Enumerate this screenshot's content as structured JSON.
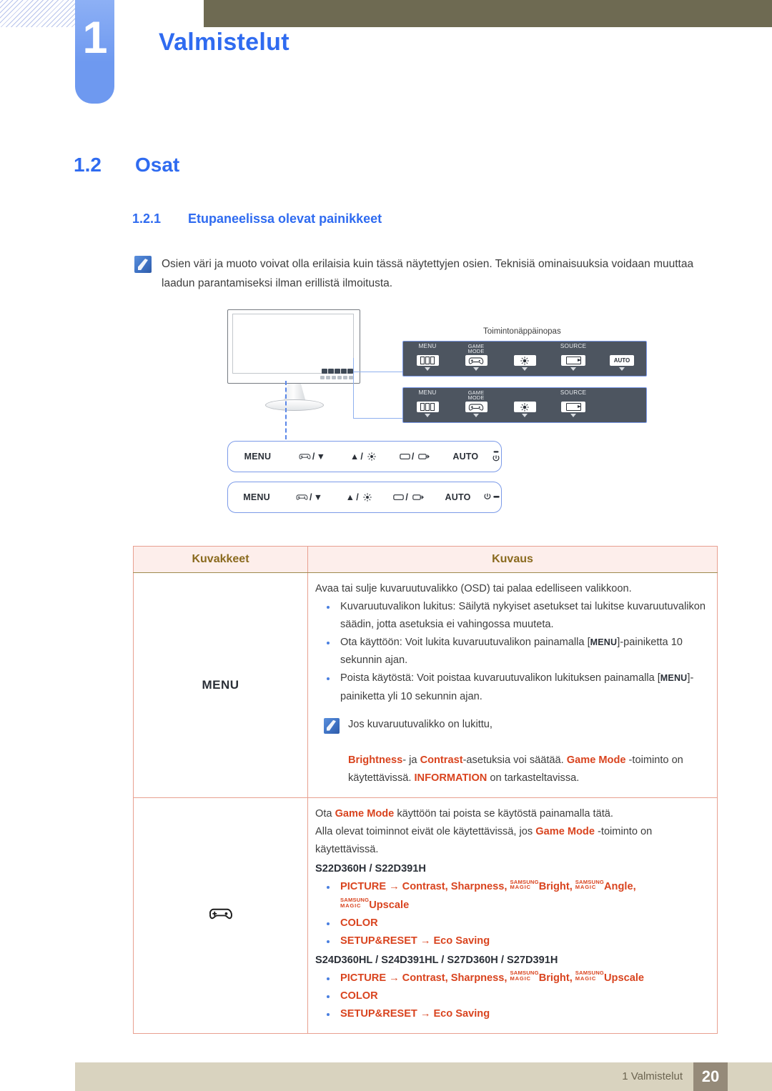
{
  "header": {
    "chapter_number": "1",
    "chapter_title": "Valmistelut"
  },
  "section": {
    "h2_number": "1.2",
    "h2_title": "Osat",
    "h3_number": "1.2.1",
    "h3_title": "Etupaneelissa olevat painikkeet"
  },
  "note": {
    "icon": "note-icon",
    "text": "Osien väri ja muoto voivat olla erilaisia kuin tässä näytettyjen osien. Teknisiä ominaisuuksia voidaan muuttaa laadun parantamiseksi ilman erillistä ilmoitusta."
  },
  "figure": {
    "guide_label": "Toimintonäppäinopas",
    "osd_panel_top": [
      {
        "caption": "MENU",
        "key": "menu-glyph",
        "arrow": true
      },
      {
        "caption": "GAME\nMODE",
        "key": "gamepad-glyph",
        "arrow": true
      },
      {
        "caption": "",
        "key": "brightness-glyph",
        "arrow": true
      },
      {
        "caption": "SOURCE",
        "key": "source-glyph",
        "arrow": true
      },
      {
        "caption": "",
        "key": "AUTO",
        "arrow": true
      }
    ],
    "osd_panel_bottom": [
      {
        "caption": "MENU",
        "key": "menu-glyph",
        "arrow": true
      },
      {
        "caption": "GAME\nMODE",
        "key": "gamepad-glyph",
        "arrow": true
      },
      {
        "caption": "",
        "key": "brightness-glyph",
        "arrow": true
      },
      {
        "caption": "SOURCE",
        "key": "source-glyph",
        "arrow": true
      }
    ],
    "button_bar_top": [
      "MENU",
      "gamepad/▼",
      "▲/brightness",
      "source/input",
      "AUTO",
      "power-led"
    ],
    "button_bar_bottom": [
      "MENU",
      "gamepad/▼",
      "▲/brightness",
      "source/input",
      "AUTO",
      "power-led"
    ],
    "bar_labels": {
      "menu": "MENU",
      "auto": "AUTO"
    }
  },
  "table": {
    "headers": {
      "icons": "Kuvakkeet",
      "description": "Kuvaus"
    },
    "rows": [
      {
        "icon_label": "MENU",
        "intro": "Avaa tai sulje kuvaruutuvalikko (OSD) tai palaa edelliseen valikkoon.",
        "bullets": [
          {
            "pre": "Kuvaruutuvalikon lukitus: Säilytä nykyiset asetukset tai lukitse kuvaruutuvalikon säädin, jotta asetuksia ei vahingossa muuteta."
          },
          {
            "pre": "Ota käyttöön: Voit lukita kuvaruutuvalikon painamalla [",
            "kbd": "MENU",
            "post": "]-painiketta 10 sekunnin ajan."
          },
          {
            "pre": "Poista käytöstä: Voit poistaa kuvaruutuvalikon lukituksen painamalla [",
            "kbd": "MENU",
            "post": "]-painiketta yli 10 sekunnin ajan."
          }
        ],
        "sub_note_line1": "Jos kuvaruutuvalikko on lukittu,",
        "sub_note_line2_parts": {
          "t1": "Brightness",
          "t2": "- ja ",
          "t3": "Contrast",
          "t4": "-asetuksia voi säätää. ",
          "t5": "Game Mode",
          "t6": " -toiminto on käytettävissä. ",
          "t7": "INFORMATION",
          "t8": " on tarkasteltavissa."
        }
      },
      {
        "icon_label": "gamepad-icon",
        "line1_parts": {
          "a": "Ota ",
          "b": "Game Mode",
          "c": " käyttöön tai poista se käytöstä painamalla tätä."
        },
        "line2_parts": {
          "a": "Alla olevat toiminnot eivät ole käytettävissä, jos ",
          "b": "Game Mode",
          "c": " -toiminto on käytettävissä."
        },
        "group1_models": "S22D360H / S22D391H",
        "group1_items": [
          {
            "head": "PICTURE",
            "arrow": "→",
            "tail": "Contrast, Sharpness, ",
            "magic1": "Bright",
            "sep": ", ",
            "magic2": "Angle",
            "sep2": ",",
            "wrap_magic": "Upscale"
          },
          {
            "head": "COLOR"
          },
          {
            "head": "SETUP&RESET",
            "arrow": "→",
            "tail": "Eco Saving"
          }
        ],
        "group2_models": "S24D360HL / S24D391HL / S27D360H / S27D391H",
        "group2_items": [
          {
            "head": "PICTURE",
            "arrow": "→",
            "tail": "Contrast, Sharpness, ",
            "magic1": "Bright",
            "sep": ", ",
            "magic2": "Upscale"
          },
          {
            "head": "COLOR"
          },
          {
            "head": "SETUP&RESET",
            "arrow": "→",
            "tail": "Eco Saving"
          }
        ],
        "magic_top": "SAMSUNG",
        "magic_bottom": "MAGIC"
      }
    ]
  },
  "footer": {
    "text": "1 Valmistelut",
    "page": "20"
  },
  "colors": {
    "accent_blue": "#2f6bf0",
    "header_band": "#6e6a52",
    "table_border_outer": "#9e8a4e",
    "table_border_inner": "#e8a090",
    "table_header_bg": "#fdeeeb",
    "orange": "#d9441f",
    "footer_bar": "#d9d3bf",
    "footer_page": "#958a79",
    "osd_panel": "#4d5560"
  }
}
